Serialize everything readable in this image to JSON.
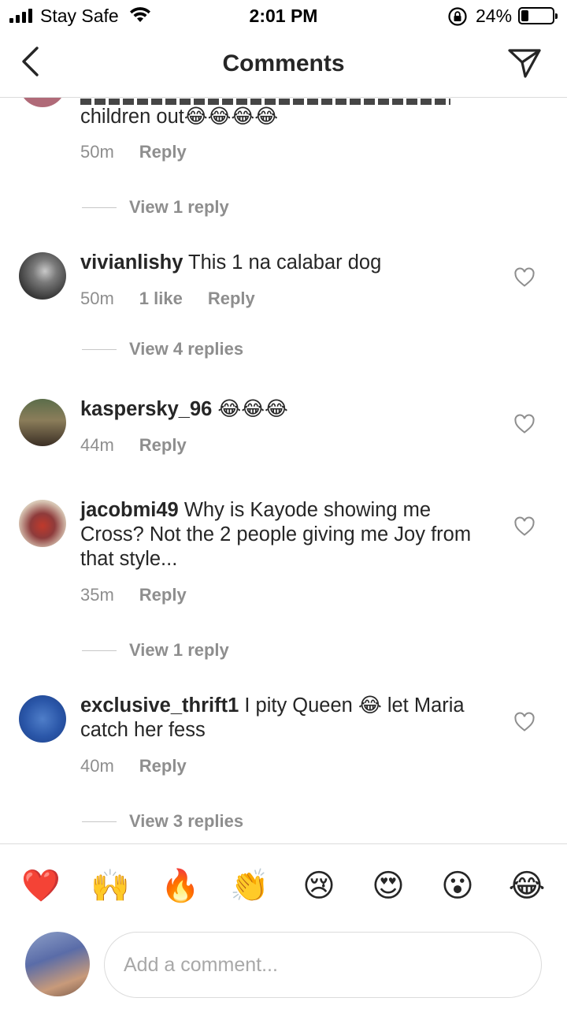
{
  "status_bar": {
    "carrier": "Stay Safe",
    "time": "2:01 PM",
    "battery_text": "24%",
    "battery_level": 0.24
  },
  "header": {
    "title": "Comments"
  },
  "partial_comment": {
    "text": "children out😂😂😂😂",
    "meta": {
      "time": "50m",
      "reply_label": "Reply"
    },
    "view_replies": "View 1 reply"
  },
  "comments": [
    {
      "username": "vivianlishy",
      "text": "This 1 na calabar dog",
      "time": "50m",
      "likes": "1 like",
      "reply_label": "Reply",
      "view_replies": "View 4 replies"
    },
    {
      "username": "kaspersky_96",
      "text": "😂😂😂",
      "time": "44m",
      "reply_label": "Reply"
    },
    {
      "username": "jacobmi49",
      "text": "Why is Kayode showing me Cross? Not the 2 people giving me Joy from that style...",
      "time": "35m",
      "reply_label": "Reply",
      "view_replies": "View 1 reply"
    },
    {
      "username": "exclusive_thrift1",
      "text": "I pity Queen 😂 let Maria catch her fess",
      "time": "40m",
      "reply_label": "Reply",
      "view_replies": "View 3 replies"
    }
  ],
  "emoji_bar": [
    "❤️",
    "🙌",
    "🔥",
    "👏",
    "😢",
    "😍",
    "😮",
    "😂"
  ],
  "composer": {
    "placeholder": "Add a comment..."
  },
  "colors": {
    "text": "#262626",
    "secondary": "#8e8e8e",
    "divider": "#dbdbdb"
  }
}
